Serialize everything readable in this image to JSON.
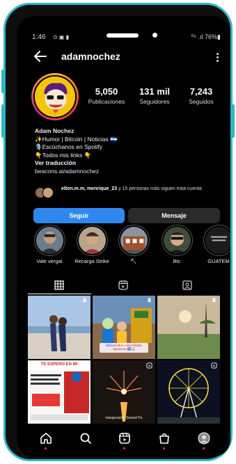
{
  "status_bar": {
    "time": "1:46",
    "notifications": "⊙ ▣ ▮",
    "signal": "⁰⁶ .ıl 76%▮"
  },
  "header": {
    "username": "adamnochez",
    "back_icon": "arrow-left-icon",
    "menu_icon": "more-vertical-icon"
  },
  "profile": {
    "stats": [
      {
        "value": "5,050",
        "label": "Publicaciones"
      },
      {
        "value": "131 mil",
        "label": "Seguidores"
      },
      {
        "value": "7,243",
        "label": "Seguidos"
      }
    ],
    "bio": {
      "name": "Adam Nochez",
      "line1": "✨Humor | Bitcoin | Noticias 🇸🇻",
      "line2": "🎙️Escúchanos en Spotify",
      "line3": "👇Todos mis links 👇",
      "translate": "Ver traducción",
      "link": "beacons.ai/adamnochez"
    },
    "followed_by": {
      "bold": "elton.m.m, menrique_23",
      "rest": " y 15 personas más",
      "suffix": " siguen esta cuenta"
    }
  },
  "actions": {
    "follow": "Seguir",
    "message": "Mensaje"
  },
  "highlights": [
    {
      "label": "Vale vergal"
    },
    {
      "label": "Recarga Strike"
    },
    {
      "label": "🔨"
    },
    {
      "label": "Btc"
    },
    {
      "label": "GUATEM"
    }
  ],
  "tabs": [
    "grid-icon",
    "reels-icon",
    "tagged-icon"
  ],
  "grid_captions": {
    "post5": "Bienvenidos a las Fiestas Agostinas 🇸🇻🎡",
    "post7": "TE ESPERO EN MI",
    "post8": "inauguración Sunset Pa"
  },
  "bottom_nav": [
    "home-icon",
    "search-icon",
    "reels-icon",
    "shop-icon",
    "profile-avatar-icon"
  ],
  "colors": {
    "accent": "#2f88ef",
    "frame": "#2fb6c4",
    "background": "#000000"
  }
}
